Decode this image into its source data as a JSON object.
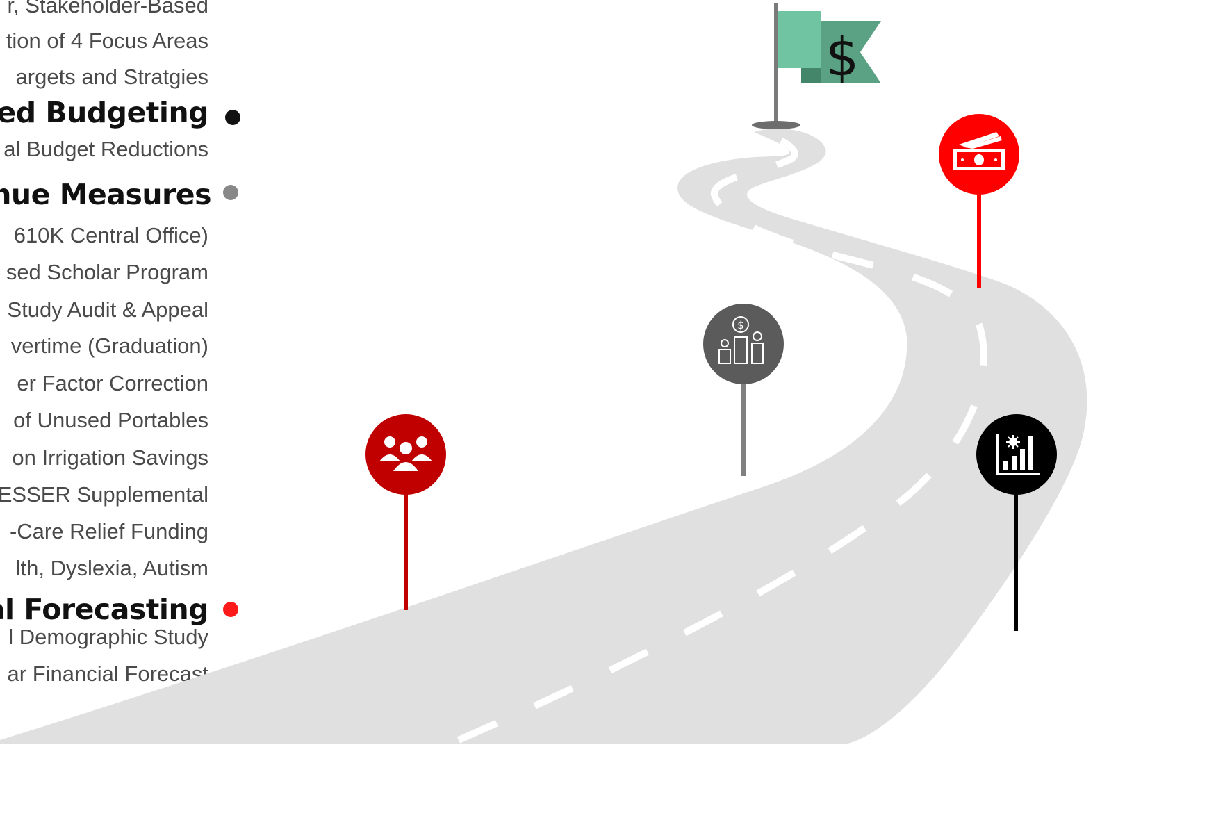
{
  "sections": [
    {
      "kind": "item",
      "text": "r, Stakeholder-Based"
    },
    {
      "kind": "item",
      "text": "tion of 4 Focus Areas"
    },
    {
      "kind": "item",
      "text": "argets and Stratgies"
    },
    {
      "kind": "heading",
      "text": "sed Budgeting",
      "dot_color": "#111111"
    },
    {
      "kind": "item",
      "text": "al Budget Reductions"
    },
    {
      "kind": "heading",
      "text": "nue Measures",
      "dot_color": "#888888"
    },
    {
      "kind": "item",
      "text": "610K Central Office)"
    },
    {
      "kind": "item",
      "text": "sed Scholar Program"
    },
    {
      "kind": "item",
      "text": "Study Audit & Appeal"
    },
    {
      "kind": "item",
      "text": "vertime (Graduation)"
    },
    {
      "kind": "item",
      "text": "er Factor Correction"
    },
    {
      "kind": "item",
      "text": "of Unused Portables"
    },
    {
      "kind": "item",
      "text": "on Irrigation Savings"
    },
    {
      "kind": "item",
      "text": "ESSER Supplemental"
    },
    {
      "kind": "item",
      "text": "-Care Relief Funding"
    },
    {
      "kind": "item",
      "text": "lth, Dyslexia, Autism"
    },
    {
      "kind": "heading",
      "text": "al Forecasting",
      "dot_color": "#ff1a1a"
    },
    {
      "kind": "item",
      "text": "l Demographic Study"
    },
    {
      "kind": "item",
      "text": "ar Financial Forecast"
    }
  ],
  "flag": {
    "symbol": "$",
    "front_color": "#70c4a2",
    "back_color": "#5aa283"
  },
  "markers": [
    {
      "name": "people-icon",
      "color": "#c00000",
      "stem_color": "#c00000"
    },
    {
      "name": "budget-priorities-icon",
      "color": "#5b5b5b",
      "stem_color": "#808080"
    },
    {
      "name": "money-icon",
      "color": "#ff0000",
      "stem_color": "#ff0000"
    },
    {
      "name": "pandemic-chart-icon",
      "color": "#000000",
      "stem_color": "#000000"
    }
  ],
  "road_color": "#e0e0e0"
}
